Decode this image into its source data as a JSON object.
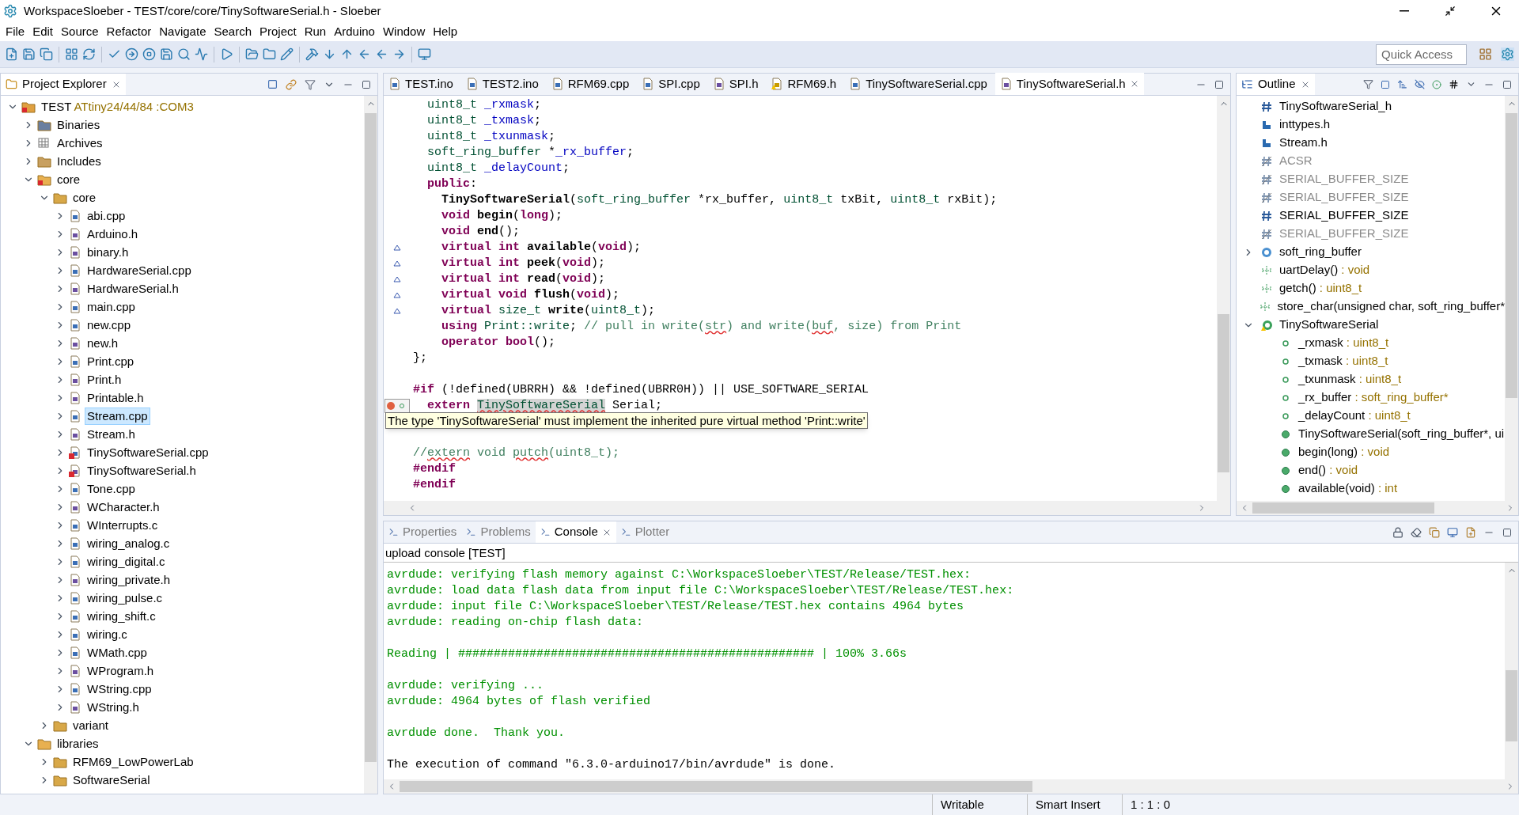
{
  "window": {
    "title": "WorkspaceSloeber - TEST/core/core/TinySoftwareSerial.h - Sloeber"
  },
  "menu": [
    "File",
    "Edit",
    "Source",
    "Refactor",
    "Navigate",
    "Search",
    "Project",
    "Run",
    "Arduino",
    "Window",
    "Help"
  ],
  "quick_access": {
    "placeholder": "Quick Access"
  },
  "project_explorer": {
    "title": "Project Explorer",
    "tree": [
      {
        "label": "TEST",
        "extra": "ATtiny24/44/84 :COM3",
        "kind": "project",
        "expanded": true,
        "selected": false,
        "children": [
          {
            "label": "Binaries",
            "kind": "binaries",
            "expanded": false,
            "selected": false
          },
          {
            "label": "Archives",
            "kind": "archives",
            "expanded": false,
            "selected": false
          },
          {
            "label": "Includes",
            "kind": "includes",
            "expanded": false,
            "selected": false
          },
          {
            "label": "core",
            "kind": "errfolder",
            "expanded": true,
            "selected": false,
            "children": [
              {
                "label": "core",
                "kind": "linkfolder",
                "expanded": true,
                "selected": false,
                "children": [
                  {
                    "label": "abi.cpp",
                    "kind": "c",
                    "expanded": false,
                    "selected": false,
                    "error": false
                  },
                  {
                    "label": "Arduino.h",
                    "kind": "h",
                    "expanded": false,
                    "selected": false,
                    "error": false
                  },
                  {
                    "label": "binary.h",
                    "kind": "h",
                    "expanded": false,
                    "selected": false,
                    "error": false
                  },
                  {
                    "label": "HardwareSerial.cpp",
                    "kind": "c",
                    "expanded": false,
                    "selected": false,
                    "error": false
                  },
                  {
                    "label": "HardwareSerial.h",
                    "kind": "h",
                    "expanded": false,
                    "selected": false,
                    "error": false
                  },
                  {
                    "label": "main.cpp",
                    "kind": "c",
                    "expanded": false,
                    "selected": false,
                    "error": false
                  },
                  {
                    "label": "new.cpp",
                    "kind": "c",
                    "expanded": false,
                    "selected": false,
                    "error": false
                  },
                  {
                    "label": "new.h",
                    "kind": "h",
                    "expanded": false,
                    "selected": false,
                    "error": false
                  },
                  {
                    "label": "Print.cpp",
                    "kind": "c",
                    "expanded": false,
                    "selected": false,
                    "error": false
                  },
                  {
                    "label": "Print.h",
                    "kind": "h",
                    "expanded": false,
                    "selected": false,
                    "error": false
                  },
                  {
                    "label": "Printable.h",
                    "kind": "h",
                    "expanded": false,
                    "selected": false,
                    "error": false
                  },
                  {
                    "label": "Stream.cpp",
                    "kind": "c",
                    "expanded": false,
                    "selected": true,
                    "error": false
                  },
                  {
                    "label": "Stream.h",
                    "kind": "h",
                    "expanded": false,
                    "selected": false,
                    "error": false
                  },
                  {
                    "label": "TinySoftwareSerial.cpp",
                    "kind": "c",
                    "expanded": false,
                    "selected": false,
                    "error": true
                  },
                  {
                    "label": "TinySoftwareSerial.h",
                    "kind": "h",
                    "expanded": false,
                    "selected": false,
                    "error": true
                  },
                  {
                    "label": "Tone.cpp",
                    "kind": "c",
                    "expanded": false,
                    "selected": false,
                    "error": false
                  },
                  {
                    "label": "WCharacter.h",
                    "kind": "h",
                    "expanded": false,
                    "selected": false,
                    "error": false
                  },
                  {
                    "label": "WInterrupts.c",
                    "kind": "c",
                    "expanded": false,
                    "selected": false,
                    "error": false
                  },
                  {
                    "label": "wiring_analog.c",
                    "kind": "c",
                    "expanded": false,
                    "selected": false,
                    "error": false
                  },
                  {
                    "label": "wiring_digital.c",
                    "kind": "c",
                    "expanded": false,
                    "selected": false,
                    "error": false
                  },
                  {
                    "label": "wiring_private.h",
                    "kind": "h",
                    "expanded": false,
                    "selected": false,
                    "error": false
                  },
                  {
                    "label": "wiring_pulse.c",
                    "kind": "c",
                    "expanded": false,
                    "selected": false,
                    "error": false
                  },
                  {
                    "label": "wiring_shift.c",
                    "kind": "c",
                    "expanded": false,
                    "selected": false,
                    "error": false
                  },
                  {
                    "label": "wiring.c",
                    "kind": "c",
                    "expanded": false,
                    "selected": false,
                    "error": false
                  },
                  {
                    "label": "WMath.cpp",
                    "kind": "c",
                    "expanded": false,
                    "selected": false,
                    "error": false
                  },
                  {
                    "label": "WProgram.h",
                    "kind": "h",
                    "expanded": false,
                    "selected": false,
                    "error": false
                  },
                  {
                    "label": "WString.cpp",
                    "kind": "c",
                    "expanded": false,
                    "selected": false,
                    "error": false
                  },
                  {
                    "label": "WString.h",
                    "kind": "h",
                    "expanded": false,
                    "selected": false,
                    "error": false
                  }
                ]
              },
              {
                "label": "variant",
                "kind": "linkfolder",
                "expanded": false,
                "selected": false
              }
            ]
          },
          {
            "label": "libraries",
            "kind": "folder",
            "expanded": true,
            "selected": false,
            "children": [
              {
                "label": "RFM69_LowPowerLab",
                "kind": "linkfolder",
                "expanded": false,
                "selected": false
              },
              {
                "label": "SoftwareSerial",
                "kind": "linkfolder",
                "expanded": false,
                "selected": false
              }
            ]
          }
        ]
      }
    ]
  },
  "editor": {
    "tabs": [
      {
        "label": "TEST.ino",
        "kind": "c",
        "selected": false
      },
      {
        "label": "TEST2.ino",
        "kind": "c",
        "selected": false
      },
      {
        "label": "RFM69.cpp",
        "kind": "c",
        "selected": false
      },
      {
        "label": "SPI.cpp",
        "kind": "c",
        "selected": false
      },
      {
        "label": "SPI.h",
        "kind": "h",
        "selected": false
      },
      {
        "label": "RFM69.h",
        "kind": "hwarn",
        "selected": false
      },
      {
        "label": "TinySoftwareSerial.cpp",
        "kind": "c",
        "selected": false
      },
      {
        "label": "TinySoftwareSerial.h",
        "kind": "h",
        "selected": true
      }
    ],
    "lines": [
      {
        "kind": "code",
        "segments": [
          {
            "t": "  uint8_t",
            "kind": "type"
          },
          {
            "t": " _rxmask",
            "kind": "field"
          },
          {
            "t": ";",
            "kind": "plain"
          }
        ]
      },
      {
        "kind": "code",
        "segments": [
          {
            "t": "  uint8_t",
            "kind": "type"
          },
          {
            "t": " _txmask",
            "kind": "field"
          },
          {
            "t": ";",
            "kind": "plain"
          }
        ]
      },
      {
        "kind": "code",
        "segments": [
          {
            "t": "  uint8_t",
            "kind": "type"
          },
          {
            "t": " _txunmask",
            "kind": "field"
          },
          {
            "t": ";",
            "kind": "plain"
          }
        ]
      },
      {
        "kind": "code",
        "segments": [
          {
            "t": "  soft_ring_buffer",
            "kind": "type"
          },
          {
            "t": " *",
            "kind": "plain"
          },
          {
            "t": "_rx_buffer",
            "kind": "field"
          },
          {
            "t": ";",
            "kind": "plain"
          }
        ]
      },
      {
        "kind": "code",
        "segments": [
          {
            "t": "  uint8_t",
            "kind": "type"
          },
          {
            "t": " _delayCount",
            "kind": "field"
          },
          {
            "t": ";",
            "kind": "plain"
          }
        ]
      },
      {
        "kind": "code",
        "segments": [
          {
            "t": "  public",
            "kind": "kw"
          },
          {
            "t": ":",
            "kind": "plain"
          }
        ]
      },
      {
        "kind": "code",
        "segments": [
          {
            "t": "    TinySoftwareSerial",
            "kind": "fn"
          },
          {
            "t": "(",
            "kind": "plain"
          },
          {
            "t": "soft_ring_buffer",
            "kind": "type"
          },
          {
            "t": " *rx_buffer, ",
            "kind": "plain"
          },
          {
            "t": "uint8_t",
            "kind": "type"
          },
          {
            "t": " txBit, ",
            "kind": "plain"
          },
          {
            "t": "uint8_t",
            "kind": "type"
          },
          {
            "t": " rxBit);",
            "kind": "plain"
          }
        ]
      },
      {
        "kind": "code",
        "segments": [
          {
            "t": "    void",
            "kind": "kw"
          },
          {
            "t": " begin",
            "kind": "fn"
          },
          {
            "t": "(",
            "kind": "plain"
          },
          {
            "t": "long",
            "kind": "kw"
          },
          {
            "t": ");",
            "kind": "plain"
          }
        ]
      },
      {
        "kind": "code",
        "segments": [
          {
            "t": "    void",
            "kind": "kw"
          },
          {
            "t": " end",
            "kind": "fn"
          },
          {
            "t": "();",
            "kind": "plain"
          }
        ]
      },
      {
        "kind": "code",
        "marker": {
          "kind": "override"
        },
        "segments": [
          {
            "t": "    virtual int",
            "kind": "kw"
          },
          {
            "t": " available",
            "kind": "fn"
          },
          {
            "t": "(",
            "kind": "plain"
          },
          {
            "t": "void",
            "kind": "kw"
          },
          {
            "t": ");",
            "kind": "plain"
          }
        ]
      },
      {
        "kind": "code",
        "marker": {
          "kind": "override"
        },
        "segments": [
          {
            "t": "    virtual int",
            "kind": "kw"
          },
          {
            "t": " peek",
            "kind": "fn"
          },
          {
            "t": "(",
            "kind": "plain"
          },
          {
            "t": "void",
            "kind": "kw"
          },
          {
            "t": ");",
            "kind": "plain"
          }
        ]
      },
      {
        "kind": "code",
        "marker": {
          "kind": "override"
        },
        "segments": [
          {
            "t": "    virtual int",
            "kind": "kw"
          },
          {
            "t": " read",
            "kind": "fn"
          },
          {
            "t": "(",
            "kind": "plain"
          },
          {
            "t": "void",
            "kind": "kw"
          },
          {
            "t": ");",
            "kind": "plain"
          }
        ]
      },
      {
        "kind": "code",
        "marker": {
          "kind": "override"
        },
        "segments": [
          {
            "t": "    virtual void",
            "kind": "kw"
          },
          {
            "t": " flush",
            "kind": "fn"
          },
          {
            "t": "(",
            "kind": "plain"
          },
          {
            "t": "void",
            "kind": "kw"
          },
          {
            "t": ");",
            "kind": "plain"
          }
        ]
      },
      {
        "kind": "code",
        "marker": {
          "kind": "override"
        },
        "segments": [
          {
            "t": "    virtual",
            "kind": "kw"
          },
          {
            "t": " size_t",
            "kind": "type"
          },
          {
            "t": " write",
            "kind": "fn"
          },
          {
            "t": "(",
            "kind": "plain"
          },
          {
            "t": "uint8_t",
            "kind": "type"
          },
          {
            "t": ");",
            "kind": "plain"
          }
        ]
      },
      {
        "kind": "code",
        "segments": [
          {
            "t": "    using",
            "kind": "kw"
          },
          {
            "t": " Print::write",
            "kind": "type"
          },
          {
            "t": "; ",
            "kind": "plain"
          },
          {
            "t": "// pull in write(",
            "kind": "comment"
          },
          {
            "t": "str",
            "kind": "comment",
            "misspelled": true
          },
          {
            "t": ") and write(",
            "kind": "comment"
          },
          {
            "t": "buf",
            "kind": "comment",
            "misspelled": true
          },
          {
            "t": ", size) from Print",
            "kind": "comment"
          }
        ]
      },
      {
        "kind": "code",
        "segments": [
          {
            "t": "    operator bool",
            "kind": "kw"
          },
          {
            "t": "();",
            "kind": "plain"
          }
        ]
      },
      {
        "kind": "code",
        "segments": [
          {
            "t": "};",
            "kind": "plain"
          }
        ]
      },
      {
        "kind": "blank"
      },
      {
        "kind": "code",
        "segments": [
          {
            "t": "#if",
            "kind": "kw"
          },
          {
            "t": " (!defined(UBRRH) && !defined(UBRR0H)) || USE_SOFTWARE_SERIAL",
            "kind": "plain"
          }
        ]
      },
      {
        "kind": "code",
        "marker": {
          "kind": "quickfix"
        },
        "segments": [
          {
            "t": "  extern ",
            "kind": "kw"
          },
          {
            "t": "TinySoftwareSerial",
            "kind": "occurrence",
            "misspelled": true
          },
          {
            "t": " Serial;",
            "kind": "plain"
          }
        ]
      },
      {
        "kind": "blank"
      },
      {
        "kind": "blank"
      },
      {
        "kind": "code",
        "segments": [
          {
            "t": "//",
            "kind": "comment"
          },
          {
            "t": "extern",
            "kind": "comment",
            "misspelled": true
          },
          {
            "t": " void ",
            "kind": "comment"
          },
          {
            "t": "putch",
            "kind": "comment",
            "misspelled": true
          },
          {
            "t": "(uint8_t);",
            "kind": "comment"
          }
        ]
      },
      {
        "kind": "code",
        "segments": [
          {
            "t": "#endif",
            "kind": "kw"
          }
        ]
      },
      {
        "kind": "code",
        "segments": [
          {
            "t": "#endif",
            "kind": "kw"
          }
        ]
      }
    ],
    "tooltip": "The type 'TinySoftwareSerial' must implement the inherited pure virtual method 'Print::write'"
  },
  "outline": {
    "title": "Outline",
    "items": [
      {
        "name": "TinySoftwareSerial_h",
        "kind": "macro",
        "disabled": false
      },
      {
        "name": "inttypes.h",
        "kind": "include",
        "disabled": false
      },
      {
        "name": "Stream.h",
        "kind": "include",
        "disabled": false
      },
      {
        "name": "ACSR",
        "kind": "macro",
        "disabled": true
      },
      {
        "name": "SERIAL_BUFFER_SIZE",
        "kind": "macro",
        "disabled": true
      },
      {
        "name": "SERIAL_BUFFER_SIZE",
        "kind": "macro",
        "disabled": true
      },
      {
        "name": "SERIAL_BUFFER_SIZE",
        "kind": "macro",
        "disabled": false
      },
      {
        "name": "SERIAL_BUFFER_SIZE",
        "kind": "macro",
        "disabled": true
      },
      {
        "name": "soft_ring_buffer",
        "kind": "struct",
        "disabled": false,
        "expanded": false
      },
      {
        "name": "uartDelay()",
        "type": " : void",
        "kind": "function",
        "disabled": false
      },
      {
        "name": "getch()",
        "type": " : uint8_t",
        "kind": "function",
        "disabled": false
      },
      {
        "name": "store_char(unsigned char, soft_ring_buffer*",
        "kind": "function",
        "disabled": false
      },
      {
        "name": "TinySoftwareSerial",
        "kind": "class",
        "disabled": false,
        "expanded": true,
        "children": [
          {
            "name": "_rxmask",
            "type": " : uint8_t",
            "kind": "field",
            "disabled": false
          },
          {
            "name": "_txmask",
            "type": " : uint8_t",
            "kind": "field",
            "disabled": false
          },
          {
            "name": "_txunmask",
            "type": " : uint8_t",
            "kind": "field",
            "disabled": false
          },
          {
            "name": "_rx_buffer",
            "type": " : soft_ring_buffer*",
            "kind": "field",
            "disabled": false
          },
          {
            "name": "_delayCount",
            "type": " : uint8_t",
            "kind": "field",
            "disabled": false
          },
          {
            "name": "TinySoftwareSerial(soft_ring_buffer*, ui",
            "kind": "method",
            "disabled": false
          },
          {
            "name": "begin(long)",
            "type": " : void",
            "kind": "method",
            "disabled": false
          },
          {
            "name": "end()",
            "type": " : void",
            "kind": "method",
            "disabled": false
          },
          {
            "name": "available(void)",
            "type": " : int",
            "kind": "method",
            "disabled": false
          }
        ]
      }
    ]
  },
  "bottom_tabs": [
    {
      "label": "Properties",
      "selected": false
    },
    {
      "label": "Problems",
      "selected": false
    },
    {
      "label": "Console",
      "selected": true
    },
    {
      "label": "Plotter",
      "selected": false
    }
  ],
  "console": {
    "title": "upload console [TEST]",
    "blocks": [
      {
        "kind": "err",
        "lines": [
          "avrdude: verifying flash memory against C:\\WorkspaceSloeber\\TEST/Release/TEST.hex:",
          "avrdude: load data flash data from input file C:\\WorkspaceSloeber\\TEST/Release/TEST.hex:",
          "avrdude: input file C:\\WorkspaceSloeber\\TEST/Release/TEST.hex contains 4964 bytes",
          "avrdude: reading on-chip flash data:"
        ]
      },
      {
        "kind": "err",
        "lines": [
          "Reading | ################################################## | 100% 3.66s"
        ]
      },
      {
        "kind": "err",
        "lines": [
          "avrdude: verifying ...",
          "avrdude: 4964 bytes of flash verified"
        ]
      },
      {
        "kind": "err",
        "lines": [
          "avrdude done.  Thank you."
        ]
      },
      {
        "kind": "out",
        "lines": [
          "The execution of command \"6.3.0-arduino17/bin/avrdude\" is done."
        ]
      }
    ]
  },
  "status_bar": [
    "Writable",
    "Smart Insert",
    "1 : 1 : 0"
  ]
}
